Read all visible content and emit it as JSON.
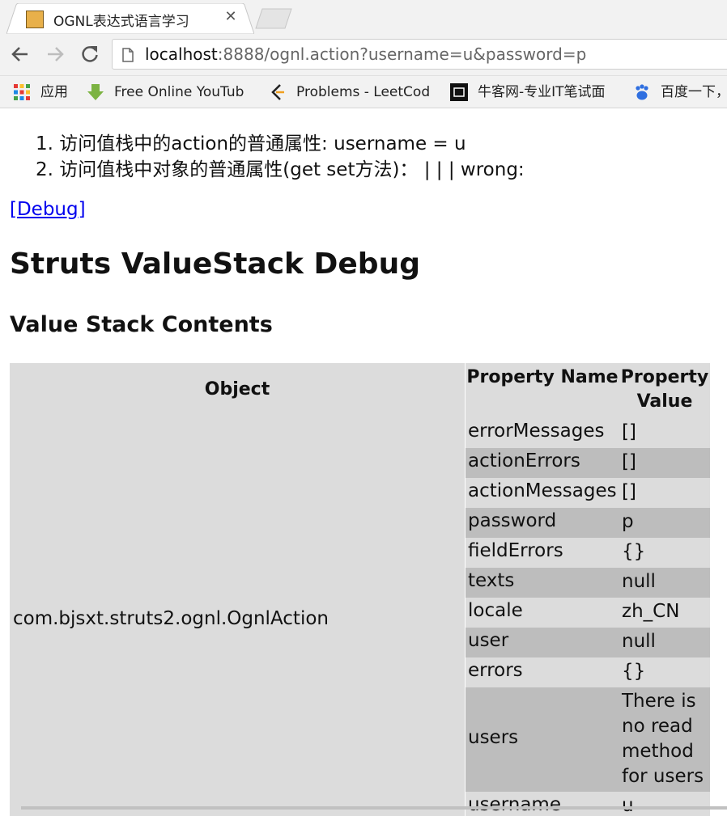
{
  "browser": {
    "tab_title": "OGNL表达式语言学习",
    "url_host": "localhost",
    "url_rest": ":8888/ognl.action?username=u&password=p",
    "bookmarks": [
      {
        "label": "应用",
        "icon": "apps-grid-icon"
      },
      {
        "label": "Free Online YouTub",
        "icon": "download-arrow-icon"
      },
      {
        "label": "Problems - LeetCod",
        "icon": "leetcode-icon"
      },
      {
        "label": "牛客网-专业IT笔试面",
        "icon": "nowcoder-icon"
      },
      {
        "label": "百度一下，",
        "icon": "baidu-paw-icon"
      }
    ]
  },
  "page": {
    "list_items": [
      "1. 访问值栈中的action的普通属性: username = u",
      "2. 访问值栈中对象的普通属性(get set方法)： | | | wrong:"
    ],
    "debug_link": "[Debug]",
    "heading": "Struts ValueStack Debug",
    "subheading": "Value Stack Contents",
    "table": {
      "headers": [
        "Object",
        "Property Name",
        "Property Value"
      ],
      "object": "com.bjsxt.struts2.ognl.OgnlAction",
      "rows": [
        {
          "name": "errorMessages",
          "value": "[]"
        },
        {
          "name": "actionErrors",
          "value": "[]"
        },
        {
          "name": "actionMessages",
          "value": "[]"
        },
        {
          "name": "password",
          "value": "p"
        },
        {
          "name": "fieldErrors",
          "value": "{}"
        },
        {
          "name": "texts",
          "value": "null"
        },
        {
          "name": "locale",
          "value": "zh_CN"
        },
        {
          "name": "user",
          "value": "null"
        },
        {
          "name": "errors",
          "value": "{}"
        },
        {
          "name": "users",
          "value": "There is no read method for users"
        },
        {
          "name": "username",
          "value": "u"
        }
      ]
    }
  },
  "colors": {
    "row_light": "#dcdcdc",
    "row_dark": "#bdbdbd",
    "link": "#0000ee"
  }
}
